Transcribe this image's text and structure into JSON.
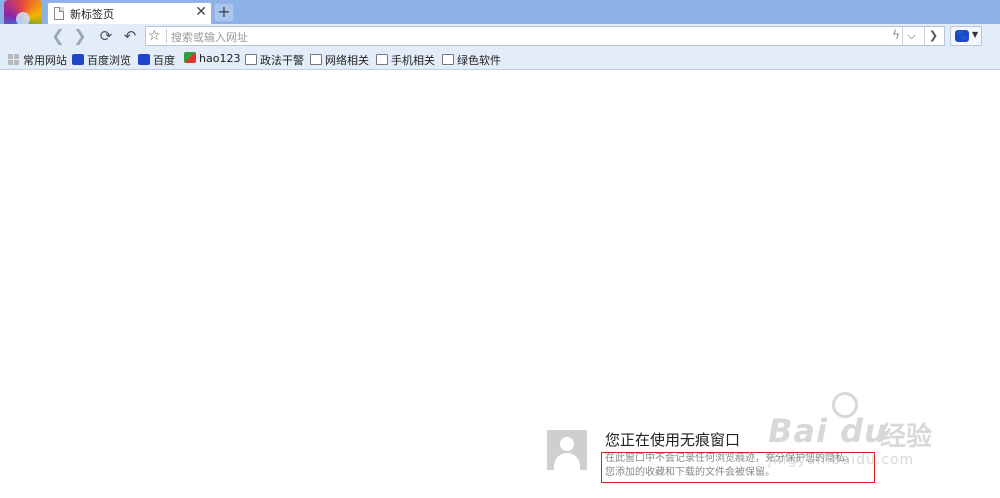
{
  "tab": {
    "title": "新标签页",
    "close": "✕"
  },
  "newtab": {
    "label": "+"
  },
  "nav": {
    "back": "❮",
    "forward": "❯",
    "refresh": "⟳",
    "undo": "↶"
  },
  "address": {
    "placeholder": "搜索或输入网址",
    "bolt": "ϟ",
    "dropdown": "⌵",
    "go": "❯",
    "star": "☆"
  },
  "search_engine": {
    "icon": "baidu-paw-icon",
    "caret": "▼"
  },
  "bookmarks": [
    {
      "label": "常用网站",
      "icon": "grid-icon"
    },
    {
      "label": "百度浏览",
      "icon": "baidu-paw-icon"
    },
    {
      "label": "百度",
      "icon": "baidu-paw-icon"
    },
    {
      "label": "hao123",
      "icon": "hao123-icon"
    },
    {
      "label": "政法干警",
      "icon": "folder-icon"
    },
    {
      "label": "网络相关",
      "icon": "folder-icon"
    },
    {
      "label": "手机相关",
      "icon": "folder-icon"
    },
    {
      "label": "绿色软件",
      "icon": "folder-icon"
    }
  ],
  "incognito": {
    "title": "您正在使用无痕窗口",
    "line1": "在此窗口中不会记录任何浏览痕迹，充分保护您的隐私。",
    "line2": "您添加的收藏和下载的文件会被保留。"
  },
  "watermark": {
    "logo": "Bai du",
    "cn": "经验",
    "url": "jingyan.baidu.com"
  },
  "colors": {
    "titlebar": "#8db2e8",
    "toolbar": "#e3ecf9",
    "highlight": "#e02020"
  }
}
